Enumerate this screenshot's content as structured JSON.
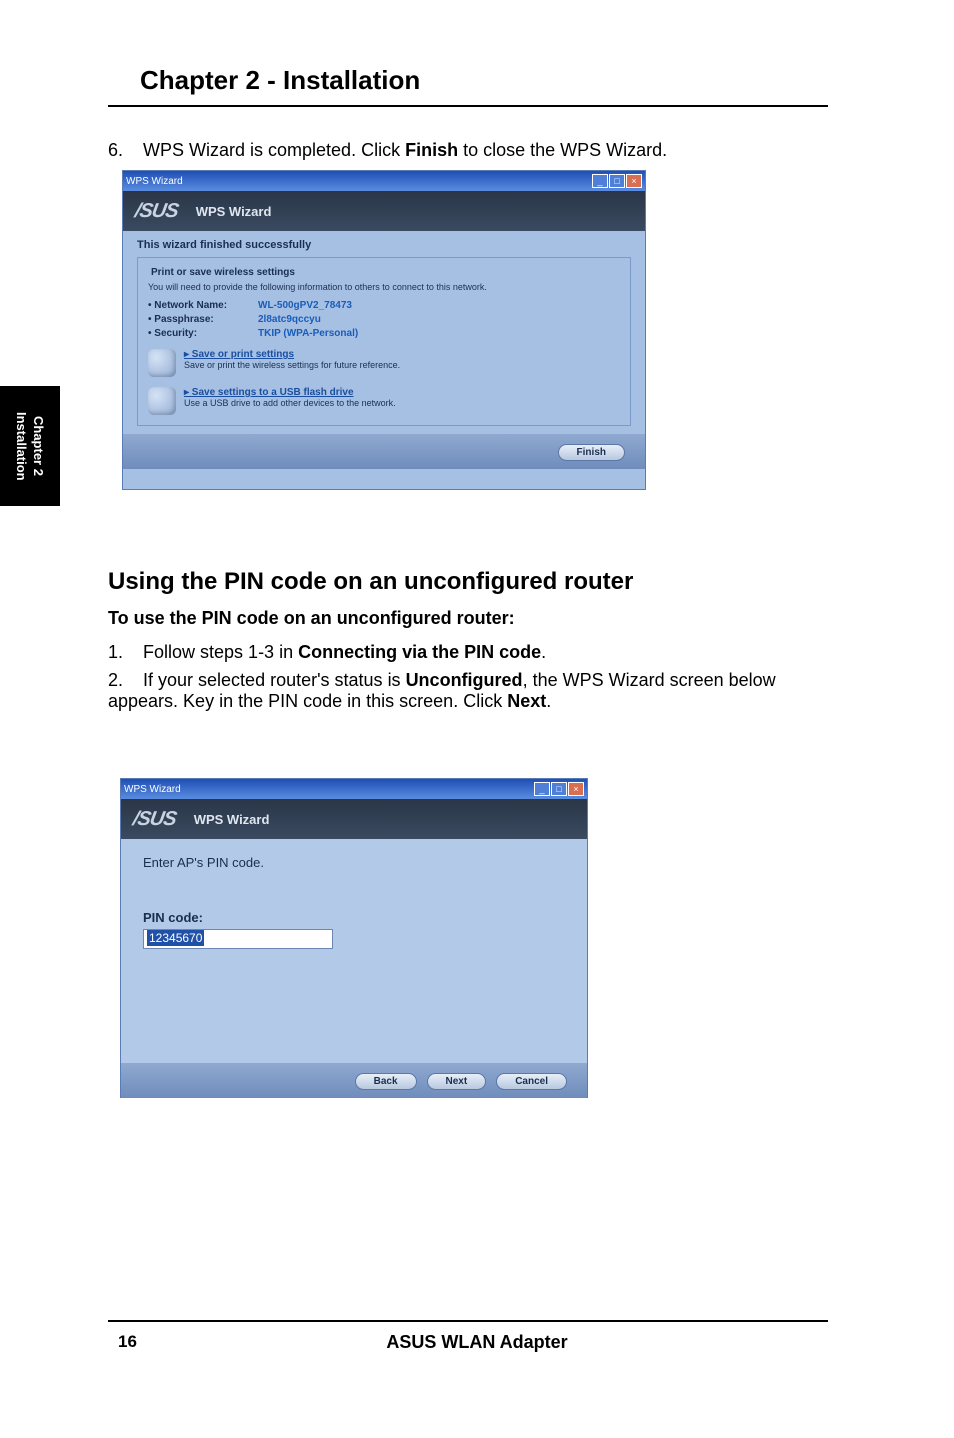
{
  "page": {
    "chapterTitle": "Chapter 2 - Installation",
    "sideTabLine1": "Chapter 2",
    "sideTabLine2": "Installation",
    "pageNumber": "16",
    "footer": "ASUS WLAN Adapter"
  },
  "step6": {
    "num": "6.",
    "pre": "WPS Wizard is completed. Click ",
    "bold": "Finish",
    "post": " to close the WPS Wizard."
  },
  "screenshot1": {
    "winTitle": "WPS Wizard",
    "minBtn": "_",
    "maxBtn": "□",
    "closeBtn": "×",
    "logo": "/SUS",
    "headerSubtitle": "WPS Wizard",
    "successMsg": "This wizard finished successfully",
    "fieldsetTitle": "Print or save wireless settings",
    "fieldsetDesc": "You will need to provide the following information to others to connect to this network.",
    "netNameLabel": "• Network Name:",
    "netNameVal": "WL-500gPV2_78473",
    "passLabel": "• Passphrase:",
    "passVal": "2l8atc9qccyu",
    "secLabel": "• Security:",
    "secVal": "TKIP (WPA-Personal)",
    "opt1Link": "▸ Save or print settings",
    "opt1Desc": "Save or print the wireless settings for future reference.",
    "opt2Link": "▸ Save settings to a USB flash drive",
    "opt2Desc": "Use a USB drive to add other devices to the network.",
    "finishBtn": "Finish"
  },
  "section": {
    "heading": "Using the PIN code on an unconfigured router",
    "subHeading": "To use the PIN code on an unconfigured router:"
  },
  "step1": {
    "num": "1.",
    "pre": "Follow steps 1-3 in ",
    "bold": "Connecting via the PIN code",
    "post": "."
  },
  "step2": {
    "num": "2.",
    "pre": "If your selected router's status is ",
    "bold1": "Unconfigured",
    "mid": ", the WPS Wizard screen below appears. Key in the PIN code in this screen. Click ",
    "bold2": "Next",
    "post": "."
  },
  "screenshot2": {
    "winTitle": "WPS Wizard",
    "minBtn": "_",
    "maxBtn": "□",
    "closeBtn": "×",
    "logo": "/SUS",
    "headerSubtitle": "WPS Wizard",
    "enterLabel": "Enter AP's PIN code.",
    "pinLabel": "PIN code:",
    "pinValue": "12345670",
    "backBtn": "Back",
    "nextBtn": "Next",
    "cancelBtn": "Cancel"
  }
}
